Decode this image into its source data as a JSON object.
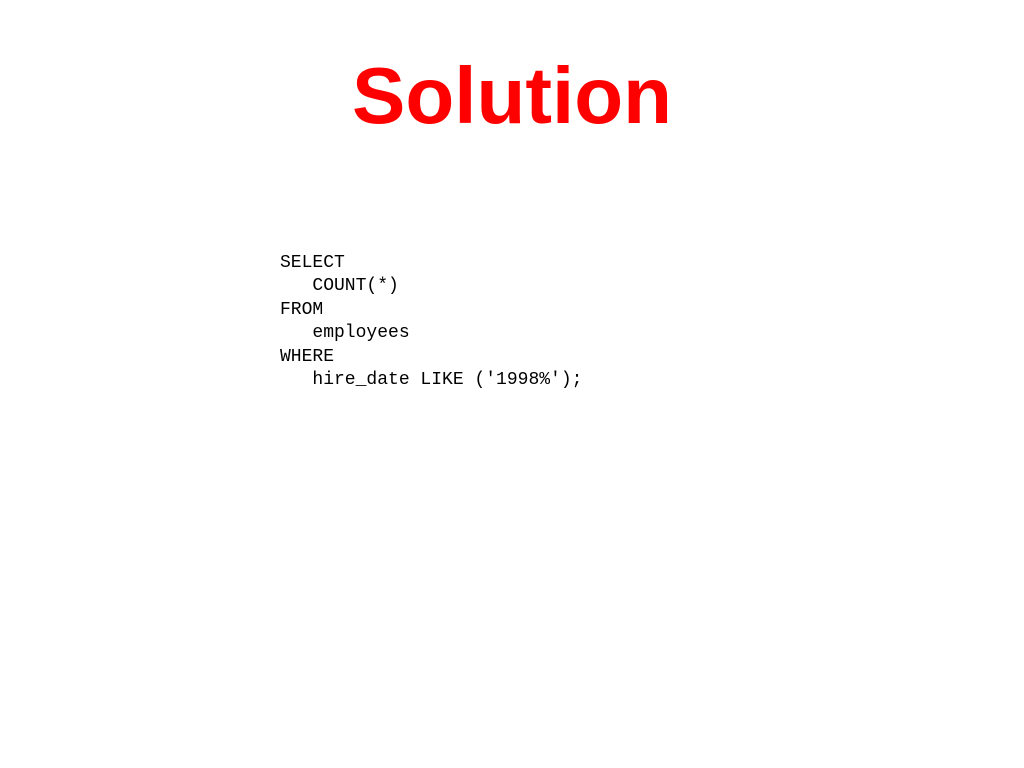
{
  "title": "Solution",
  "code": "SELECT\n   COUNT(*)\nFROM\n   employees\nWHERE\n   hire_date LIKE ('1998%');"
}
